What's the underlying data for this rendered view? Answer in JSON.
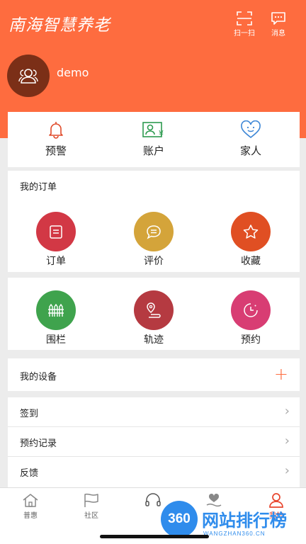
{
  "header": {
    "logo": "南海智慧养老",
    "scan_label": "扫一扫",
    "message_label": "消息",
    "username": "demo"
  },
  "quick": [
    {
      "label": "预警",
      "icon": "bell-icon"
    },
    {
      "label": "账户",
      "icon": "account-icon"
    },
    {
      "label": "家人",
      "icon": "heart-icon"
    }
  ],
  "orders": {
    "title": "我的订单",
    "items": [
      {
        "label": "订单",
        "color": "#d23845",
        "icon": "order-icon"
      },
      {
        "label": "评价",
        "color": "#d4a43a",
        "icon": "comment-icon"
      },
      {
        "label": "收藏",
        "color": "#e04f23",
        "icon": "star-icon"
      }
    ]
  },
  "tools": [
    {
      "label": "围栏",
      "color": "#3fa34d",
      "icon": "fence-icon"
    },
    {
      "label": "轨迹",
      "color": "#b53a41",
      "icon": "track-icon"
    },
    {
      "label": "预约",
      "color": "#d83d73",
      "icon": "clock-icon"
    }
  ],
  "devices": {
    "title": "我的设备",
    "plus": "+"
  },
  "menu": [
    {
      "label": "签到"
    },
    {
      "label": "预约记录"
    },
    {
      "label": "反馈"
    }
  ],
  "tabs": [
    {
      "label": "普惠"
    },
    {
      "label": "社区"
    },
    {
      "label": ""
    },
    {
      "label": ""
    },
    {
      "label": "我的"
    }
  ],
  "watermark": {
    "text": "网站排行榜",
    "badge": "360",
    "sub": "WANGZHAN360.CN"
  },
  "colors": {
    "primary": "#fe6c3f",
    "active_tab": "#e8452d"
  }
}
